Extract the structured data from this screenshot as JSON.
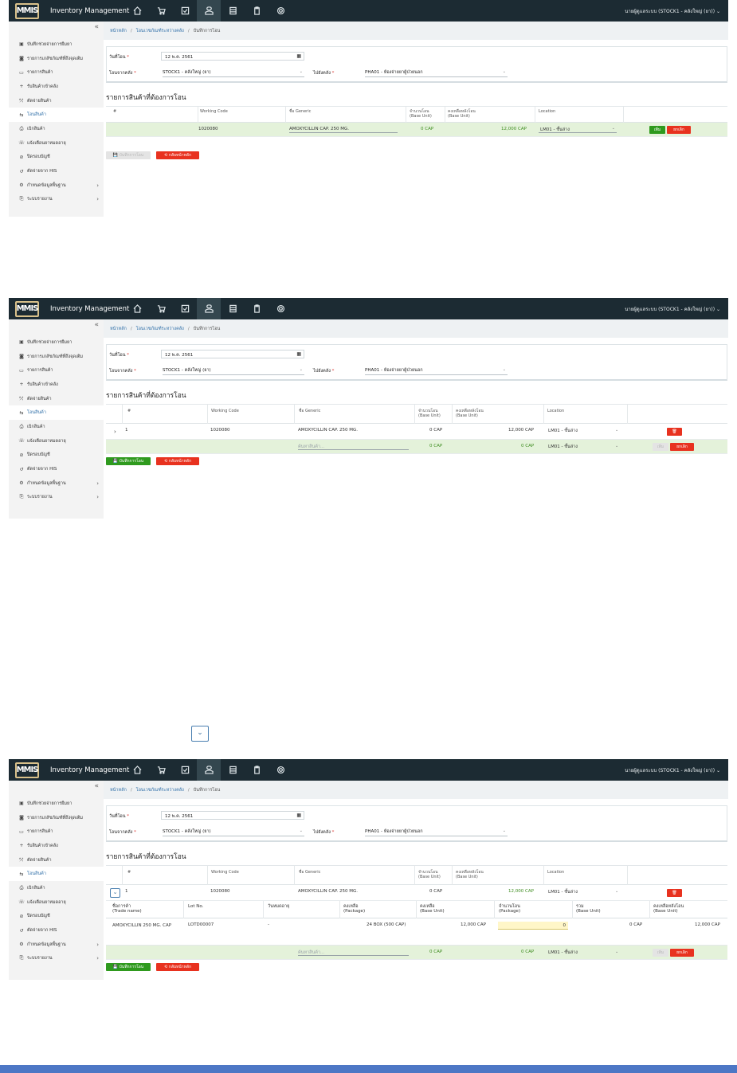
{
  "app": {
    "title": "Inventory Management",
    "logo_text": "MMIS",
    "user": "นายผู้ดูแลระบบ (STOCK1 - คลังใหญ่ (ยา)) ⌄"
  },
  "nav": {
    "icons": [
      "home-icon",
      "cart-icon",
      "check-box-icon",
      "hand-medicine-icon",
      "layers-icon",
      "clipboard-icon",
      "gear-icon"
    ]
  },
  "sidebar": {
    "collapse": "«",
    "items": [
      {
        "icon": "▣",
        "label": "บันทึกช่วยจ่ายการยืมยา"
      },
      {
        "icon": "◙",
        "label": "รายการเภสัชภัณฑ์ที่ถึงจุดเติม"
      },
      {
        "icon": "▭",
        "label": "รายการสินค้า"
      },
      {
        "icon": "+",
        "label": "รับสินค้าเข้าคลัง"
      },
      {
        "icon": "⤲",
        "label": "ตัดจ่ายสินค้า"
      },
      {
        "icon": "⇆",
        "label": "โอนสินค้า"
      },
      {
        "icon": "⎙",
        "label": "เบิกสินค้า"
      },
      {
        "icon": "☏",
        "label": "แจ้งเตือนยาหมดอายุ"
      },
      {
        "icon": "⊘",
        "label": "ปิดรอบบัญชี"
      },
      {
        "icon": "↺",
        "label": "ตัดจ่ายจาก HIS"
      },
      {
        "icon": "⚙",
        "label": "กำหนดข้อมูลพื้นฐาน"
      },
      {
        "icon": "⎘",
        "label": "ระบบรายงาน"
      }
    ]
  },
  "breadcrumb": {
    "home": "หน้าหลัก",
    "transfer": "โอนเวชภัณฑ์ระหว่างคลัง",
    "current": "บันทึกการโอน"
  },
  "form": {
    "date_label": "วันที่โอน",
    "date_value": "12 พ.ค. 2561",
    "from_label": "โอนจากคลัง",
    "from_value": "STOCK1 - คลังใหญ่ (ยา)",
    "to_label": "ไปยังคลัง",
    "to_value": "PHA01 - ห้องจ่ายยาผู้ป่วยนอก"
  },
  "section_title": "รายการสินค้าที่ต้องการโอน",
  "table": {
    "col_no": "#",
    "col_code": "Working Code",
    "col_generic": "ชื่อ Generic",
    "col_qty": "จำนวนโอน",
    "col_qty_sub": "(Base Unit)",
    "col_remain": "คงเหลือหลังโอน",
    "col_remain_sub": "(Base Unit)",
    "col_location": "Location"
  },
  "row": {
    "no": "1",
    "code": "1020080",
    "generic": "AMOXYCILLIN CAP. 250 MG.",
    "qty": "0 CAP",
    "remain": "12,000 CAP",
    "location": "LM01 - ชั้นล่าง",
    "search_placeholder": "ค้นหาสินค้า..."
  },
  "buttons": {
    "add": "เพิ่ม",
    "cancel": "ยกเลิก",
    "delete": "🗑",
    "save": "💾 บันทึกการโอน",
    "back": "⟲ กลับหน้าหลัก"
  },
  "sub_table": {
    "col_trade": "ชื่อการค้า",
    "col_trade_sub": "(Trade name)",
    "col_lot": "Lot No.",
    "col_expire": "วันหมดอายุ",
    "col_pkg_remain": "คงเหลือ",
    "col_pkg_remain_sub": "(Package)",
    "col_base_remain": "คงเหลือ",
    "col_base_remain_sub": "(Base Unit)",
    "col_transfer_pkg": "จำนวนโอน",
    "col_transfer_pkg_sub": "(Package)",
    "col_total": "รวม",
    "col_total_sub": "(Base Unit)",
    "col_after": "คงเหลือหลังโอน",
    "col_after_sub": "(Base Unit)",
    "trade_name": "AMOXYCILLIN 250 MG. CAP",
    "lot": "LOTD00007",
    "expire": "-",
    "pkg_remain": "24 BOX (500 CAP)",
    "base_remain": "12,000 CAP",
    "transfer_value": "0",
    "total": "0 CAP",
    "after": "12,000 CAP"
  },
  "expand_label": "⌄"
}
